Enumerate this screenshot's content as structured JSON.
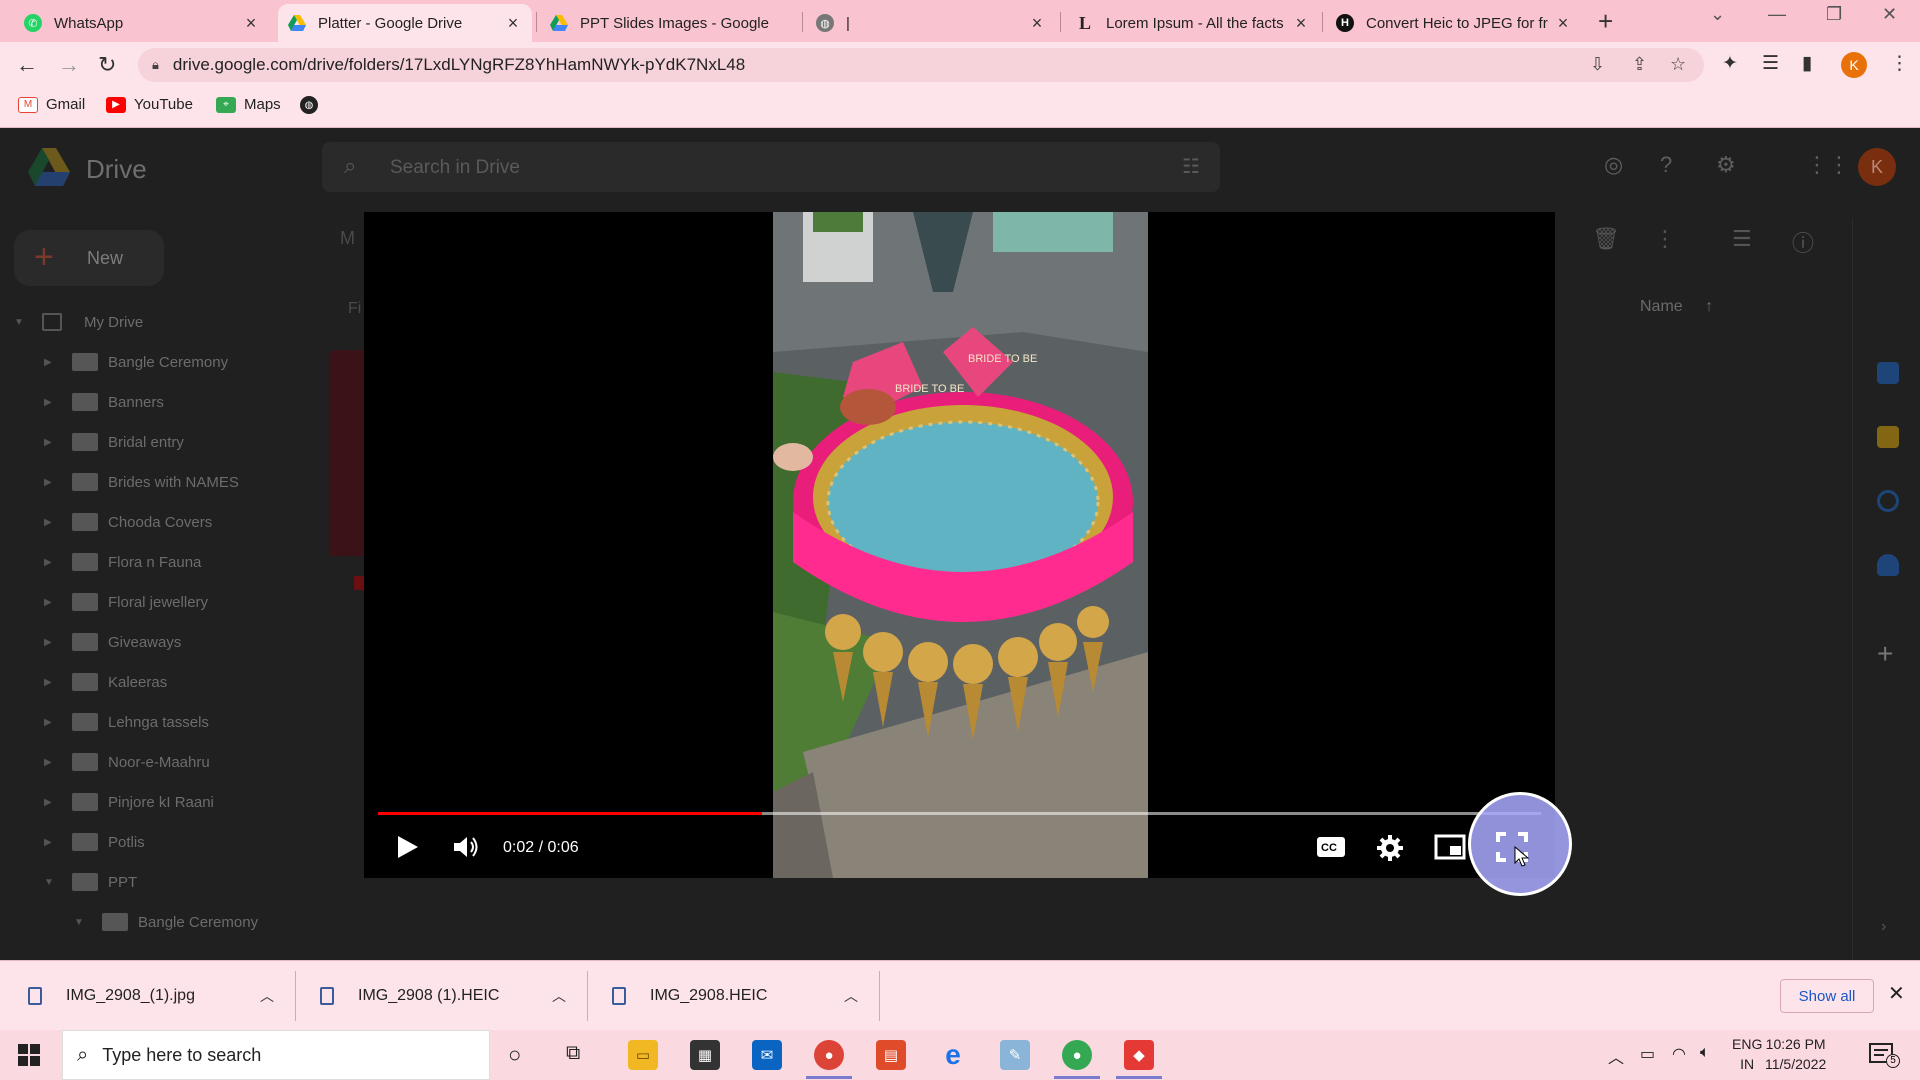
{
  "browser": {
    "tabs": [
      {
        "title": "WhatsApp",
        "favicon": "whatsapp-icon",
        "active": false
      },
      {
        "title": "Platter - Google Drive",
        "favicon": "google-drive-icon",
        "active": true
      },
      {
        "title": "PPT Slides Images - Google",
        "favicon": "google-drive-icon",
        "active": false
      },
      {
        "title": "|",
        "favicon": "globe-icon",
        "active": false
      },
      {
        "title": "Lorem Ipsum - All the facts",
        "favicon": "lipsum-icon",
        "active": false
      },
      {
        "title": "Convert Heic to JPEG for fre",
        "favicon": "h-icon",
        "active": false
      }
    ],
    "url": "drive.google.com/drive/folders/17LxdLYNgRFZ8YhHamNWYk-pYdK7NxL48",
    "profile_initial": "K",
    "bookmarks": [
      {
        "label": "Gmail",
        "icon": "gmail-icon"
      },
      {
        "label": "YouTube",
        "icon": "youtube-icon"
      },
      {
        "label": "Maps",
        "icon": "maps-icon"
      },
      {
        "label": "",
        "icon": "globe-icon"
      }
    ]
  },
  "drive": {
    "app_name": "Drive",
    "search_placeholder": "Search in Drive",
    "avatar_initial": "K",
    "new_label": "New",
    "breadcrumb_partial": "M",
    "filter_partial": "Fi",
    "sort_label": "Name",
    "sort_direction": "ascending",
    "tree": [
      {
        "label": "My Drive",
        "level": 0,
        "expanded": true
      },
      {
        "label": "Bangle Ceremony",
        "level": 1,
        "expanded": false
      },
      {
        "label": "Banners",
        "level": 1,
        "expanded": false
      },
      {
        "label": "Bridal entry",
        "level": 1,
        "expanded": false
      },
      {
        "label": "Brides with NAMES",
        "level": 1,
        "expanded": false
      },
      {
        "label": "Chooda Covers",
        "level": 1,
        "expanded": false
      },
      {
        "label": "Flora n Fauna",
        "level": 1,
        "expanded": false
      },
      {
        "label": "Floral jewellery",
        "level": 1,
        "expanded": false
      },
      {
        "label": "Giveaways",
        "level": 1,
        "expanded": false
      },
      {
        "label": "Kaleeras",
        "level": 1,
        "expanded": false
      },
      {
        "label": "Lehnga tassels",
        "level": 1,
        "expanded": false
      },
      {
        "label": "Noor-e-Maahru",
        "level": 1,
        "expanded": false
      },
      {
        "label": "Pinjore kI Raani",
        "level": 1,
        "expanded": false
      },
      {
        "label": "Potlis",
        "level": 1,
        "expanded": false
      },
      {
        "label": "PPT",
        "level": 1,
        "expanded": true
      },
      {
        "label": "Bangle Ceremony",
        "level": 2,
        "expanded": true
      }
    ]
  },
  "player": {
    "time_display": "0:02 / 0:06",
    "progress_fraction": 0.33,
    "state": "paused",
    "controls": [
      "play-icon",
      "volume-icon",
      "cc-icon",
      "settings-icon",
      "miniplayer-icon",
      "fullscreen-icon"
    ],
    "video_text": {
      "pillow_left": "BRIDE TO BE",
      "pillow_right": "BRIDE TO BE"
    }
  },
  "downloads": {
    "items": [
      {
        "name": "IMG_2908_(1).jpg"
      },
      {
        "name": "IMG_2908 (1).HEIC"
      },
      {
        "name": "IMG_2908.HEIC"
      }
    ],
    "show_all_label": "Show all"
  },
  "taskbar": {
    "search_placeholder": "Type here to search",
    "lang_top": "ENG",
    "lang_bottom": "IN",
    "time": "10:26 PM",
    "date": "11/5/2022",
    "notification_count": "5"
  },
  "colors": {
    "tabbar_bg": "#f9c3cf",
    "toolbar_bg": "#fde4ea",
    "progress_red": "#ff0000",
    "highlight": "#aaaaff"
  }
}
